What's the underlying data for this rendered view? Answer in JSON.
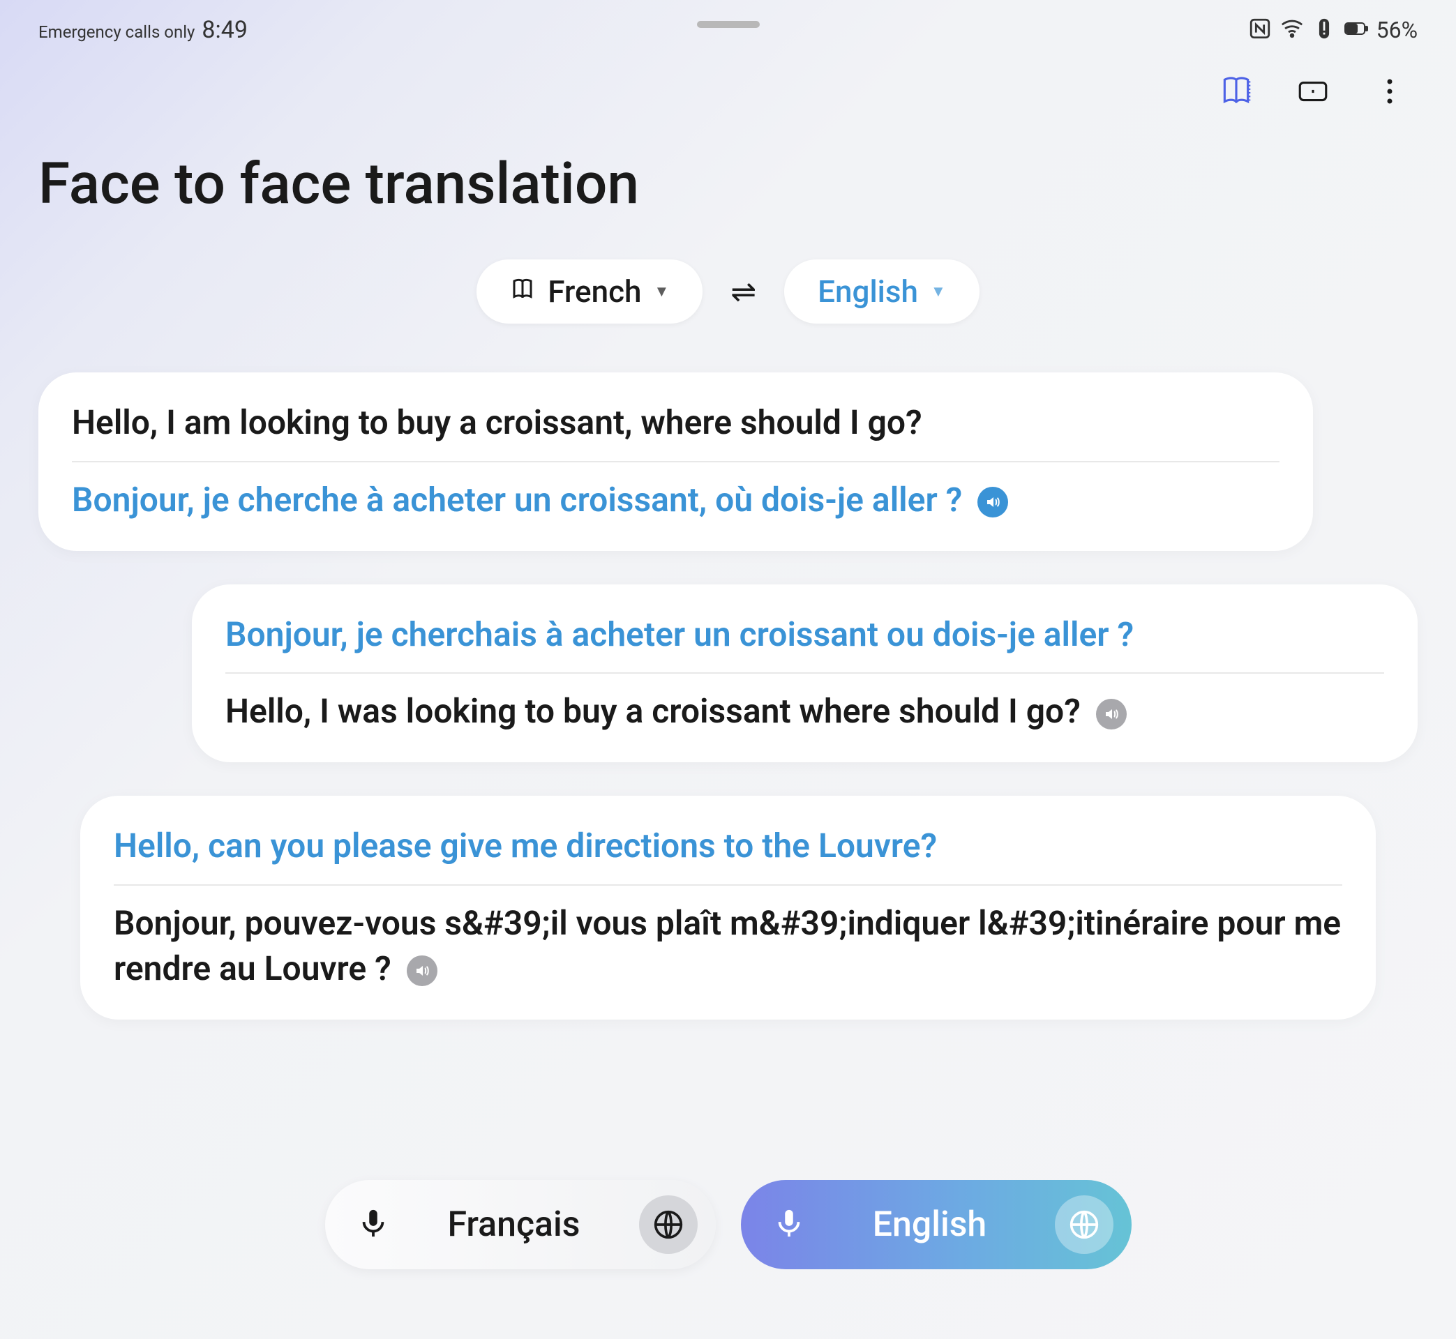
{
  "status": {
    "emergency": "Emergency calls only",
    "time": "8:49",
    "battery_pct": "56%"
  },
  "title": "Face to face translation",
  "langs": {
    "left": "French",
    "right": "English"
  },
  "messages": [
    {
      "align": "left",
      "line1_text": "Hello, I am looking to buy a croissant, where should I go?",
      "line1_color": "black",
      "line2_text": "Bonjour, je cherche à acheter un croissant, où dois-je aller ?",
      "line2_color": "blue",
      "speaker": "blue"
    },
    {
      "align": "right",
      "line1_text": "Bonjour, je cherchais à acheter un croissant ou dois-je aller ?",
      "line1_color": "blue",
      "line2_text": "Hello, I was looking to buy a croissant where should I go?",
      "line2_color": "black",
      "speaker": "gray"
    },
    {
      "align": "mid",
      "line1_text": "Hello, can you please give me directions to the Louvre?",
      "line1_color": "blue",
      "line2_text": "Bonjour, pouvez-vous s&#39;il vous plaît m&#39;indiquer l&#39;itinéraire pour me rendre au Louvre ?",
      "line2_color": "black",
      "speaker": "gray"
    }
  ],
  "bottom": {
    "left_label": "Français",
    "right_label": "English"
  }
}
